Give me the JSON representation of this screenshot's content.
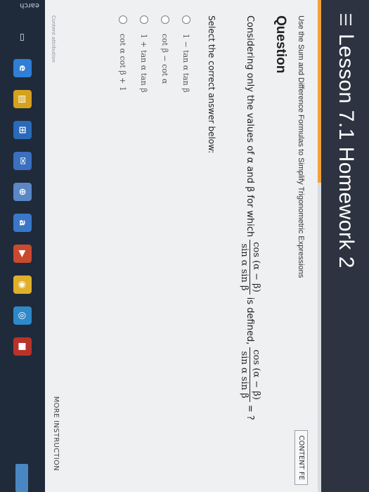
{
  "header": {
    "menu_icon": "menu-icon",
    "title": "Lesson 7.1 Homework 2"
  },
  "question": {
    "subtitle": "Use the Sum and Difference Formulas to Simplify Trigonometric Expressions",
    "heading": "Question",
    "prompt_start": "Considering only the values of α and β for which",
    "prompt_mid": "is defined,",
    "frac_num": "cos (α − β)",
    "frac_den": "sin α sin β",
    "equals_q": "= ?",
    "select_label": "Select the correct answer below:",
    "options": [
      "1 − tan α tan β",
      "cot β − cot α",
      "1 + tan α tan β",
      "cot α cot β + 1"
    ],
    "more_instructions": "MORE INSTRUCTION",
    "content_button": "CONTENT FE",
    "attribution": "Content attribution"
  },
  "taskbar": {
    "search_label": "earch",
    "icons": [
      "windows-icon",
      "task-view-icon",
      "edge-icon",
      "file-explorer-icon",
      "store-icon",
      "mail-icon",
      "photos-icon",
      "app-icon",
      "chrome-icon",
      "cortana-icon",
      "other-icon"
    ]
  },
  "colors": {
    "header_bg": "#2d3340",
    "accent": "#f0a23a",
    "page_bg": "#eef0f2",
    "taskbar_bg": "#1f2b3a"
  }
}
